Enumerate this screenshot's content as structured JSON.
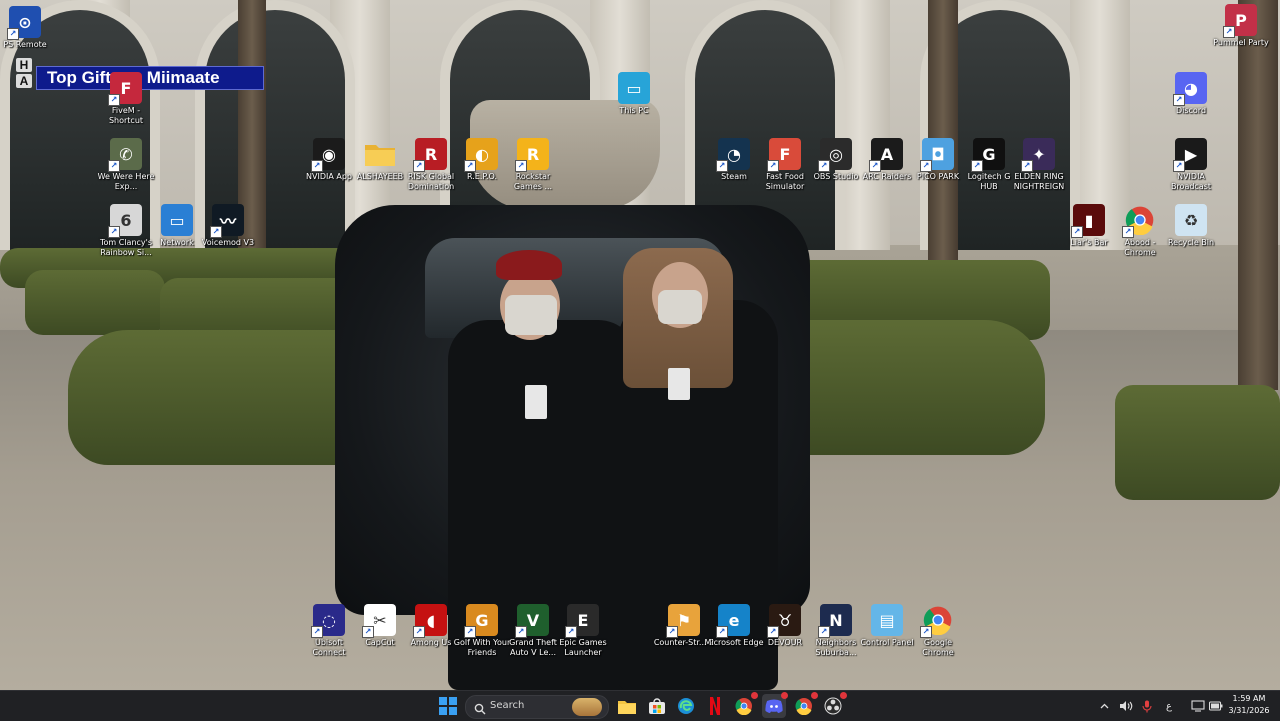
{
  "overlay": {
    "gifters_label": "Top Gifters: Miimaate",
    "ha_letters": [
      "H",
      "A"
    ]
  },
  "desktop_icons": [
    {
      "id": "ps-remote",
      "label": "PS Remote",
      "icon": "ps-remote-icon",
      "color": "#1f4fb0",
      "glyph": "⊙"
    },
    {
      "id": "fivem",
      "label": "FiveM - Shortcut",
      "icon": "fivem-icon",
      "color": "#c5283d",
      "glyph": "F"
    },
    {
      "id": "we-were-here",
      "label": "We Were Here Exp...",
      "icon": "walkie-talkie-icon",
      "color": "#5b6b4a",
      "glyph": "✆"
    },
    {
      "id": "rainbow-six",
      "label": "Tom Clancy's Rainbow Si...",
      "icon": "rainbow-six-icon",
      "color": "#d7d7d7",
      "glyph": "6"
    },
    {
      "id": "network",
      "label": "Network",
      "icon": "network-icon",
      "color": "#2a7fd4",
      "glyph": "▭"
    },
    {
      "id": "voicemod",
      "label": "Voicemod V3",
      "icon": "voicemod-icon",
      "color": "#101a24",
      "glyph": "〰"
    },
    {
      "id": "nvidia-app",
      "label": "NVIDIA App",
      "icon": "nvidia-icon",
      "color": "#1b1b1b",
      "glyph": "◉"
    },
    {
      "id": "alshayeeb",
      "label": "ALSHAYEEB",
      "icon": "folder-icon",
      "color": "#f2c94c",
      "glyph": ""
    },
    {
      "id": "risk",
      "label": "RISK Global Domination",
      "icon": "risk-icon",
      "color": "#b81d24",
      "glyph": "R"
    },
    {
      "id": "repo",
      "label": "R.E.P.O.",
      "icon": "repo-icon",
      "color": "#e6a21b",
      "glyph": "◐"
    },
    {
      "id": "rockstar",
      "label": "Rockstar Games ...",
      "icon": "rockstar-icon",
      "color": "#f4b31a",
      "glyph": "R"
    },
    {
      "id": "this-pc",
      "label": "This PC",
      "icon": "monitor-icon",
      "color": "#27a4d8",
      "glyph": "▭"
    },
    {
      "id": "steam",
      "label": "Steam",
      "icon": "steam-icon",
      "color": "#14334f",
      "glyph": "◔"
    },
    {
      "id": "fast-food",
      "label": "Fast Food Simulator",
      "icon": "fast-food-icon",
      "color": "#d94b3a",
      "glyph": "F"
    },
    {
      "id": "obs",
      "label": "OBS Studio",
      "icon": "obs-icon",
      "color": "#2b2b2b",
      "glyph": "◎"
    },
    {
      "id": "arc-raiders",
      "label": "ARC Raiders",
      "icon": "arc-raiders-icon",
      "color": "#1b1b1b",
      "glyph": "A"
    },
    {
      "id": "pico-park",
      "label": "PICO PARK",
      "icon": "pico-park-icon",
      "color": "#4ea1e0",
      "glyph": "◘"
    },
    {
      "id": "logitech",
      "label": "Logitech G HUB",
      "icon": "logitech-icon",
      "color": "#101010",
      "glyph": "G"
    },
    {
      "id": "elden-ring",
      "label": "ELDEN RING NIGHTREIGN",
      "icon": "elden-ring-icon",
      "color": "#3a2b59",
      "glyph": "✦"
    },
    {
      "id": "nvidia-broadcast",
      "label": "NVIDIA Broadcast",
      "icon": "nvidia-broadcast-icon",
      "color": "#1a1a1a",
      "glyph": "▶"
    },
    {
      "id": "pummel-party",
      "label": "Pummel Party",
      "icon": "pummel-party-icon",
      "color": "#c23048",
      "glyph": "P"
    },
    {
      "id": "discord",
      "label": "Discord",
      "icon": "discord-icon",
      "color": "#5865f2",
      "glyph": "◕"
    },
    {
      "id": "liars-bar",
      "label": "Liar's Bar",
      "icon": "liars-bar-icon",
      "color": "#5a0b0b",
      "glyph": "▮"
    },
    {
      "id": "abood-chrome",
      "label": "Abood - Chrome",
      "icon": "chrome-icon",
      "color": "#ffffff",
      "glyph": "●"
    },
    {
      "id": "recycle-bin",
      "label": "Recycle Bin",
      "icon": "recycle-bin-icon",
      "color": "#cfe4f2",
      "glyph": "♻"
    },
    {
      "id": "ubisoft",
      "label": "Ubisoft Connect",
      "icon": "ubisoft-icon",
      "color": "#2a2a8a",
      "glyph": "◌"
    },
    {
      "id": "capcut",
      "label": "CapCut",
      "icon": "capcut-icon",
      "color": "#ffffff",
      "glyph": "✂"
    },
    {
      "id": "among-us",
      "label": "Among Us",
      "icon": "among-us-icon",
      "color": "#c51111",
      "glyph": "◖"
    },
    {
      "id": "golf",
      "label": "Golf With Your Friends",
      "icon": "golf-icon",
      "color": "#d98a1f",
      "glyph": "G"
    },
    {
      "id": "gta-v",
      "label": "Grand Theft Auto V Le...",
      "icon": "gta-v-icon",
      "color": "#1f5f2d",
      "glyph": "V"
    },
    {
      "id": "epic",
      "label": "Epic Games Launcher",
      "icon": "epic-games-icon",
      "color": "#2a2a2a",
      "glyph": "E"
    },
    {
      "id": "counter-strike",
      "label": "Counter-Str... 2",
      "icon": "counter-strike-icon",
      "color": "#e8a33b",
      "glyph": "⚑"
    },
    {
      "id": "edge",
      "label": "Microsoft Edge",
      "icon": "edge-icon",
      "color": "#1583c9",
      "glyph": "e"
    },
    {
      "id": "devour",
      "label": "DEVOUR",
      "icon": "devour-icon",
      "color": "#2a1a12",
      "glyph": "♉"
    },
    {
      "id": "neighbors",
      "label": "Neighbors Suburba...",
      "icon": "neighbors-icon",
      "color": "#1d2b4f",
      "glyph": "N"
    },
    {
      "id": "control-panel",
      "label": "Control Panel",
      "icon": "control-panel-icon",
      "color": "#64b6e8",
      "glyph": "▤"
    },
    {
      "id": "google-chrome",
      "label": "Google Chrome",
      "icon": "chrome-icon",
      "color": "#ffffff",
      "glyph": "●"
    }
  ],
  "taskbar": {
    "search_label": "Search",
    "language": "ع",
    "clock_time": "1:59 AM",
    "clock_date": "3/31/2026",
    "pinned": [
      {
        "id": "start",
        "icon": "windows-start-icon"
      },
      {
        "id": "file-explorer",
        "icon": "folder-icon"
      },
      {
        "id": "store",
        "icon": "store-icon"
      },
      {
        "id": "edge",
        "icon": "edge-icon"
      },
      {
        "id": "netflix",
        "icon": "netflix-icon"
      },
      {
        "id": "chrome",
        "icon": "chrome-icon"
      },
      {
        "id": "discord",
        "icon": "discord-icon"
      },
      {
        "id": "chrome-profile",
        "icon": "chrome-icon"
      },
      {
        "id": "obs",
        "icon": "obs-icon"
      }
    ]
  }
}
